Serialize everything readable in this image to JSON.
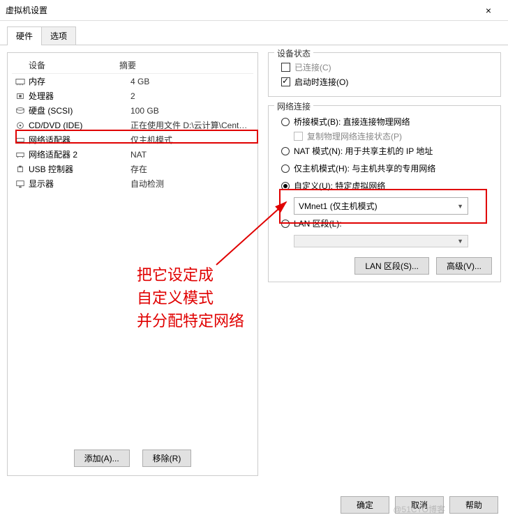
{
  "window": {
    "title": "虚拟机设置"
  },
  "tabs": {
    "hardware": "硬件",
    "options": "选项"
  },
  "hw": {
    "header_device": "设备",
    "header_summary": "摘要",
    "rows": [
      {
        "device": "内存",
        "summary": "4 GB"
      },
      {
        "device": "处理器",
        "summary": "2"
      },
      {
        "device": "硬盘 (SCSI)",
        "summary": "100 GB"
      },
      {
        "device": "CD/DVD (IDE)",
        "summary": "正在使用文件 D:\\云计算\\CentO..."
      },
      {
        "device": "网络适配器",
        "summary": "仅主机模式"
      },
      {
        "device": "网络适配器 2",
        "summary": "NAT"
      },
      {
        "device": "USB 控制器",
        "summary": "存在"
      },
      {
        "device": "显示器",
        "summary": "自动检测"
      }
    ],
    "add_btn": "添加(A)...",
    "remove_btn": "移除(R)"
  },
  "status": {
    "legend": "设备状态",
    "connected": "已连接(C)",
    "connect_on_start": "启动时连接(O)"
  },
  "net": {
    "legend": "网络连接",
    "bridged": "桥接模式(B): 直接连接物理网络",
    "replicate": "复制物理网络连接状态(P)",
    "nat": "NAT 模式(N): 用于共享主机的 IP 地址",
    "hostonly": "仅主机模式(H): 与主机共享的专用网络",
    "custom": "自定义(U): 特定虚拟网络",
    "custom_value": "VMnet1 (仅主机模式)",
    "lan": "LAN 区段(L):",
    "lan_btn": "LAN 区段(S)...",
    "adv_btn": "高级(V)..."
  },
  "footer": {
    "ok": "确定",
    "cancel": "取消",
    "help": "帮助"
  },
  "annotation": {
    "l1": "把它设定成",
    "l2": "自定义模式",
    "l3": "并分配特定网络"
  },
  "watermark": "@51CTO博客"
}
